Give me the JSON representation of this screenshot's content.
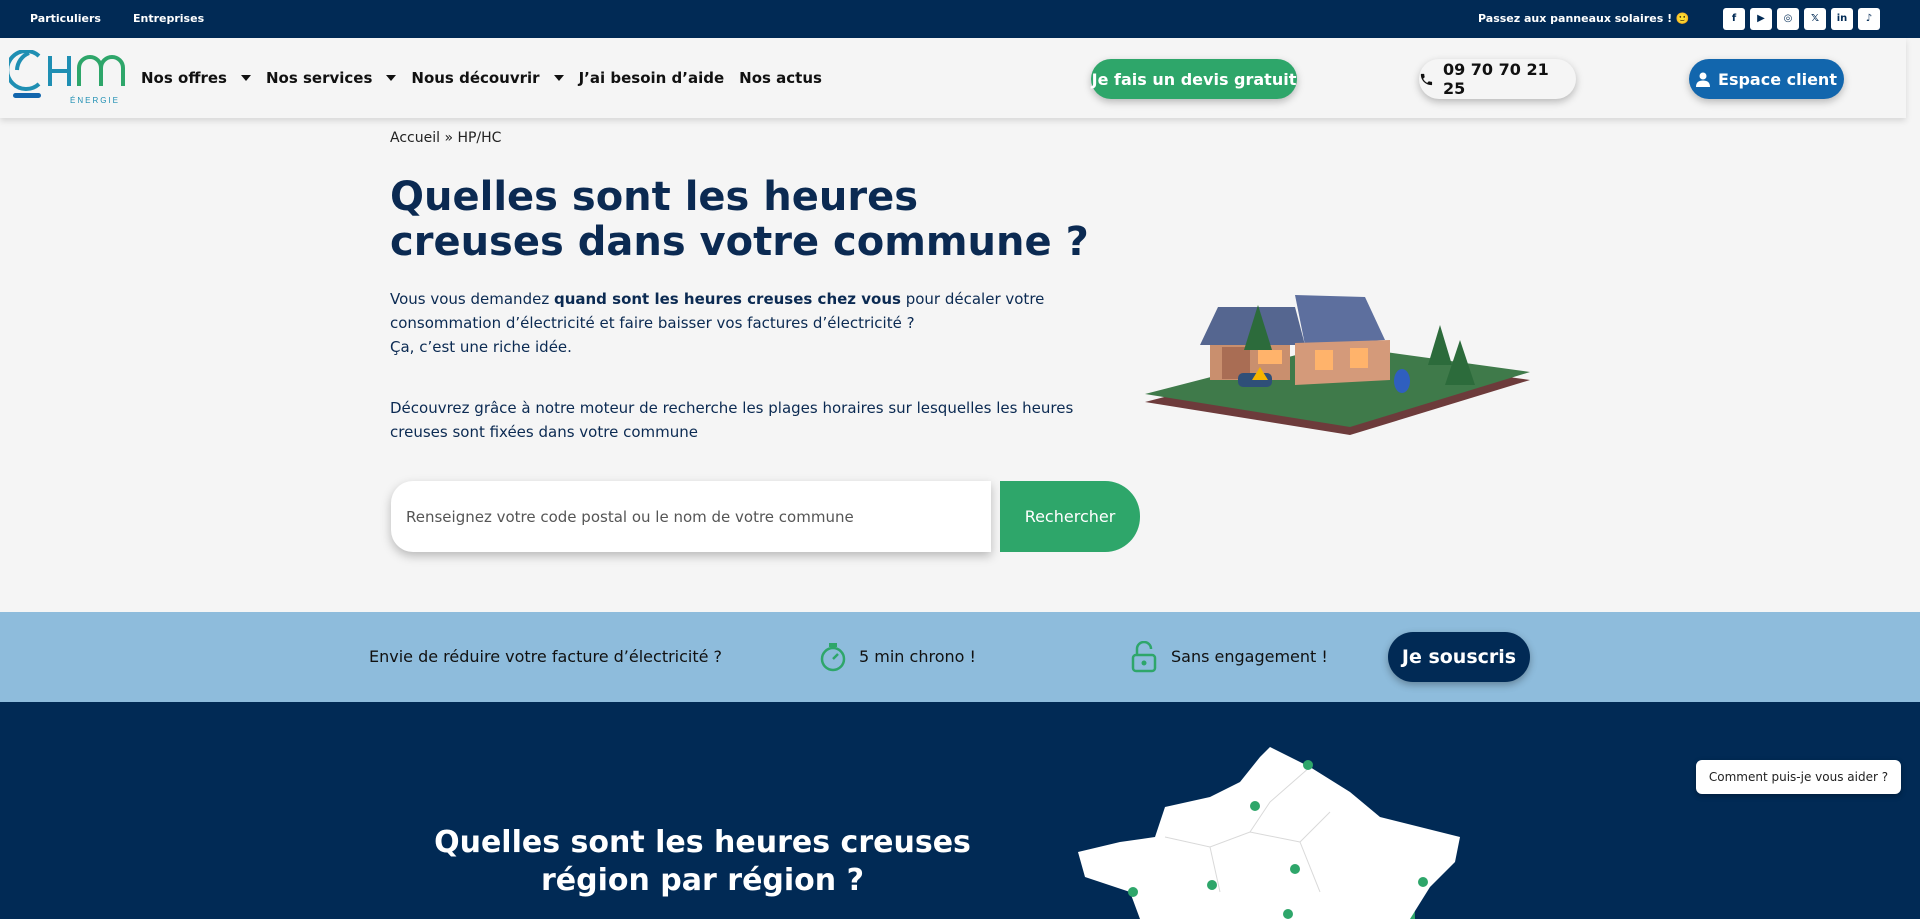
{
  "topbar": {
    "segments": [
      "Particuliers",
      "Entreprises"
    ],
    "promo": "Passez aux panneaux solaires ! 🙂",
    "socials": [
      {
        "icon": "facebook-icon",
        "glyph": "f"
      },
      {
        "icon": "youtube-icon",
        "glyph": "▶"
      },
      {
        "icon": "instagram-icon",
        "glyph": "◎"
      },
      {
        "icon": "x-icon",
        "glyph": "𝕏"
      },
      {
        "icon": "linkedin-icon",
        "glyph": "in"
      },
      {
        "icon": "tiktok-icon",
        "glyph": "♪"
      }
    ]
  },
  "logo": {
    "letters": "OHM",
    "sub": "ÉNERGIE"
  },
  "nav": {
    "items": [
      {
        "label": "Nos offres",
        "dropdown": true
      },
      {
        "label": "Nos services",
        "dropdown": true
      },
      {
        "label": "Nous découvrir",
        "dropdown": true
      },
      {
        "label": "J’ai besoin d’aide",
        "dropdown": false
      },
      {
        "label": "Nos actus",
        "dropdown": false
      }
    ]
  },
  "header_buttons": {
    "devis": "Je fais un devis gratuit",
    "phone": "09 70 70 21 25",
    "espace": "Espace client"
  },
  "breadcrumb": "Accueil » HP/HC",
  "hero": {
    "title": "Quelles sont les heures creuses dans votre commune ?",
    "intro_before": "Vous vous demandez ",
    "intro_bold": "quand sont les heures creuses chez vous",
    "intro_after": " pour décaler votre consommation d’électricité et faire baisser vos factures d’électricité ?",
    "intro_line2": "Ça, c’est une riche idée.",
    "intro2": "Découvrez grâce à notre moteur de recherche les plages horaires sur lesquelles les heures creuses sont fixées dans votre commune"
  },
  "search": {
    "placeholder": "Renseignez votre code postal ou le nom de votre commune",
    "value": "",
    "button": "Rechercher"
  },
  "band": {
    "text1": "Envie de réduire votre facture d’électricité ?",
    "text2": "5 min chrono !",
    "text3": "Sans engagement !",
    "cta": "Je souscris"
  },
  "section2": {
    "title": "Quelles sont les heures creuses région par région ?"
  },
  "chat": "Comment puis-je vous aider ?",
  "colors": {
    "navy": "#012a55",
    "green": "#2ea66a",
    "blue": "#1266ad",
    "band": "#8ebcdc"
  }
}
